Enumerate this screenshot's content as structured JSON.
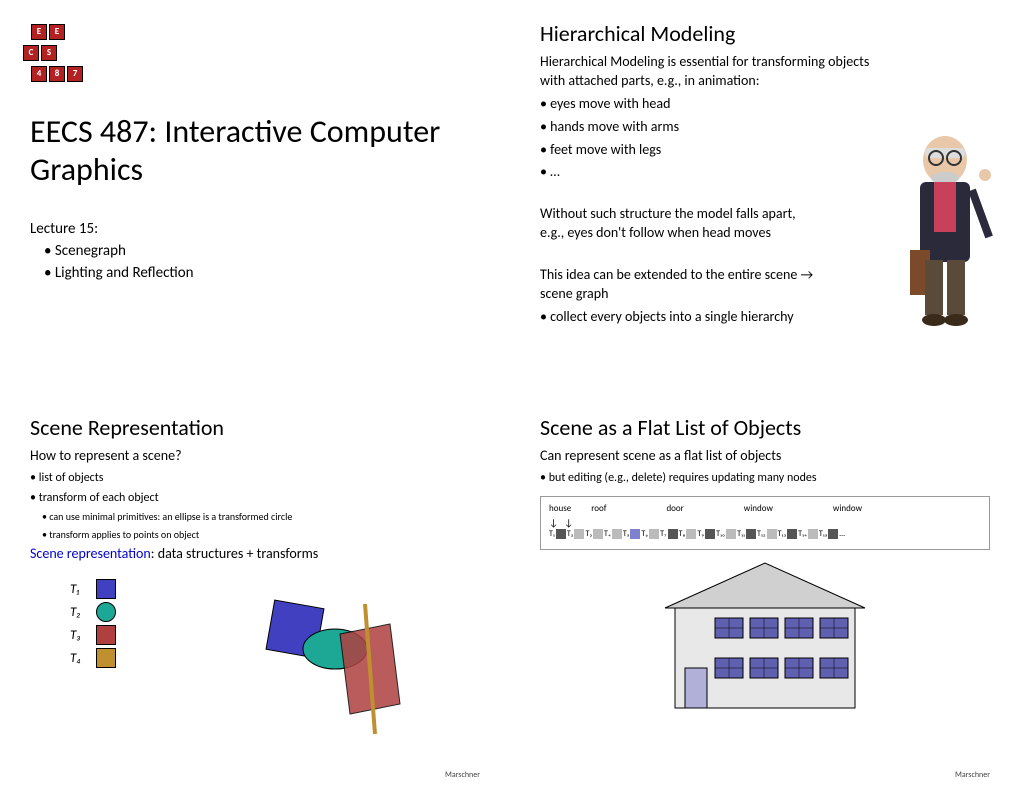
{
  "q1": {
    "title": "EECS 487: Interactive Computer Graphics",
    "lecture": "Lecture 15:",
    "bullets": [
      "Scenegraph",
      "Lighting and Reflection"
    ]
  },
  "q2": {
    "heading": "Hierarchical Modeling",
    "intro": "Hierarchical Modeling is essential for transforming objects with attached parts, e.g., in animation:",
    "bullets": [
      "eyes move with head",
      "hands move with arms",
      "feet move with legs",
      "…"
    ],
    "para1": "Without such structure the model falls apart, e.g., eyes don't follow when head moves",
    "para2": "This idea can be extended to the entire scene → scene graph",
    "sub": "collect every objects into a single hierarchy"
  },
  "q3": {
    "heading": "Scene Representation",
    "question": "How to represent a scene?",
    "bullets": [
      "list of objects",
      "transform of each object"
    ],
    "subbullets": [
      "can use minimal primitives: an ellipse is a transformed circle",
      "transform applies to points on object"
    ],
    "blue_label": "Scene representation",
    "blue_rest": ": data structures + transforms",
    "legend": [
      "T₁",
      "T₂",
      "T₃",
      "T₄"
    ],
    "attribution": "Marschner"
  },
  "q4": {
    "heading": "Scene as a Flat List of Objects",
    "intro": "Can represent scene as a flat list of objects",
    "sub": "but editing (e.g., delete) requires updating many nodes",
    "labels": [
      "house",
      "roof",
      "door",
      "window",
      "window"
    ],
    "attribution": "Marschner"
  }
}
